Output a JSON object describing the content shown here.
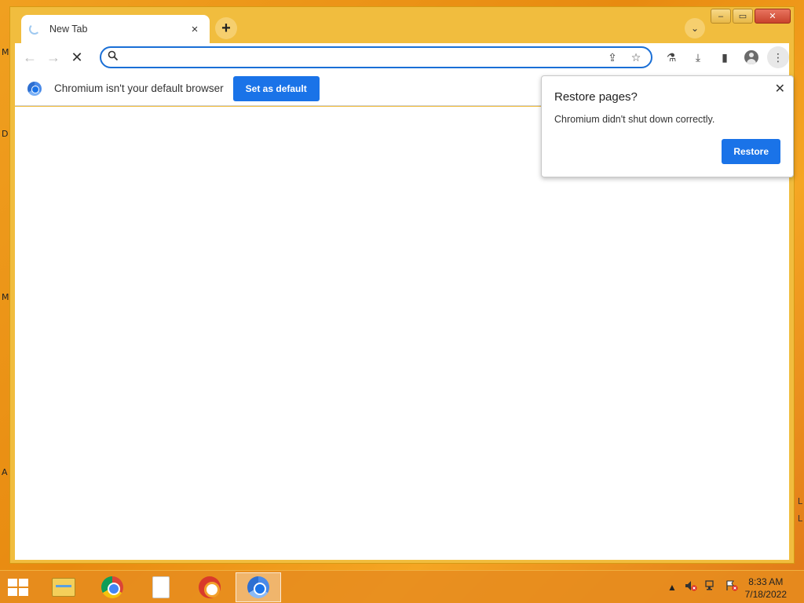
{
  "window": {
    "tab_title": "New Tab",
    "tab_close": "×",
    "new_tab": "+",
    "tab_search": "⌄",
    "controls": {
      "minimize": "–",
      "maximize": "▭",
      "close": "✕"
    }
  },
  "toolbar": {
    "back": "←",
    "forward": "→",
    "stop": "✕",
    "omnibox_value": "",
    "omnibox_placeholder": "",
    "share": "⇪",
    "bookmark": "☆",
    "labs": "⚗",
    "download": "⤓",
    "side_panel": "▮",
    "menu": "⋮"
  },
  "infobar": {
    "message": "Chromium isn't your default browser",
    "button": "Set as default"
  },
  "popup": {
    "title": "Restore pages?",
    "message": "Chromium didn't shut down correctly.",
    "button": "Restore",
    "close": "✕"
  },
  "desktop": {
    "edge_letters": [
      "M",
      "D",
      "M",
      "A"
    ],
    "edge_ticks": [
      "L",
      "L"
    ]
  },
  "taskbar": {
    "tray_arrow": "▲",
    "clock_time": "8:33 AM",
    "clock_date": "7/18/2022"
  },
  "colors": {
    "accent": "#1a73e8",
    "frame": "#f1bd3e",
    "taskbar": "#e68c1e"
  }
}
